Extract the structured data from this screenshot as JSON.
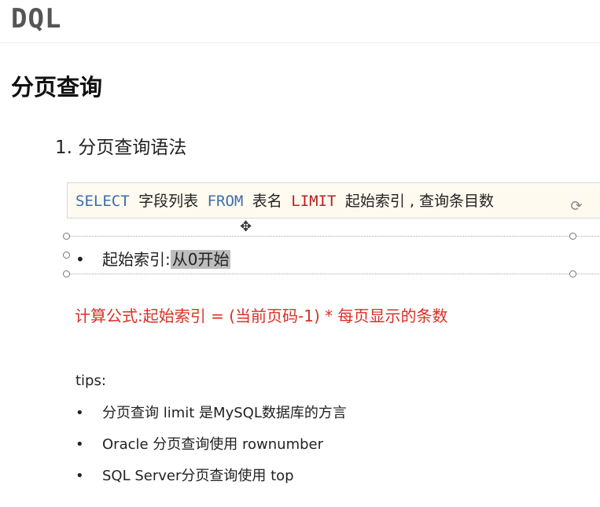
{
  "header": {
    "title": "DQL"
  },
  "section": {
    "title": "分页查询"
  },
  "subheading": "1. 分页查询语法",
  "code": {
    "kw_select": "SELECT",
    "t1": "字段列表",
    "kw_from": "FROM",
    "t2": "表名",
    "kw_limit": "LIMIT",
    "t3": "起始索引 , 查询条目数"
  },
  "bullet": {
    "label": "起始索引:",
    "highlight": "从0开始"
  },
  "formula": "计算公式:起始索引 = (当前页码-1) * 每页显示的条数",
  "tips": {
    "label": "tips:",
    "items": [
      "分页查询 limit 是MySQL数据库的方言",
      "Oracle 分页查询使用 rownumber",
      "SQL Server分页查询使用 top"
    ]
  },
  "colors": {
    "keyword": "#3c6ea8",
    "limit": "#b22222",
    "formula": "#d93025"
  },
  "icons": [
    "rotate-handle-icon",
    "move-cursor-icon"
  ]
}
